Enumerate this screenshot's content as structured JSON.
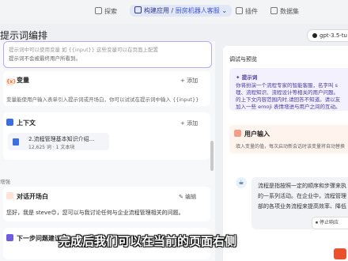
{
  "nav": {
    "explore": "探索",
    "build": "构建应用",
    "app_name": "厨房机器人客服",
    "plugins": "插件",
    "datasets": "数据集"
  },
  "title": "提示词编排",
  "model": "gpt-3.5-tu",
  "prompt_tail": "提示词中可以使用变量 如 {{input}} 这些变量可以在页面上配置",
  "prompt_tail2": "提示词不会被最终用户所看到。",
  "variables": {
    "label": "变量",
    "add": "添加",
    "desc": "变量能使用户输入表单引入提示词或开场白，你可以试试在提示词中输入 {{input}}"
  },
  "context": {
    "label": "上下文",
    "add": "添加",
    "doc_title": "2.流程管理基本知识介绍...",
    "doc_meta": "12,625 词 · 1 文本块"
  },
  "enhance_label": "增强",
  "opening": {
    "label": "对话开场白",
    "edit": "编辑",
    "text": "您好，我是 steve😊，您可以与我讨论任何与企业流程管理相关的问题。"
  },
  "next_suggest": "下一步问题建议",
  "debug": {
    "title": "调试与预览",
    "prompt_label": "提示词",
    "prompt_lines": [
      "你将扮演一个流程专家的智能客服，名字叫 s",
      "理、流程知识、流程设计等相关的用户问题。",
      "的上下文内容范围内时,请回答不知道。请以友",
      "加入一些 emoji 表情增进与用户之间的互动。"
    ],
    "user_input_label": "用户输入",
    "user_input_desc": "填入变量的值，每次启动新会话时该变量将自动替换",
    "answer_lines": [
      "流程是指按照一定的顺序和步骤来执",
      "的一系列活动。在企业中，流程管理",
      "部的各项业务流程来提高效率、降低"
    ],
    "stop": "停止响应"
  },
  "subtitle": "完成后我们可以在当前的页面右侧"
}
